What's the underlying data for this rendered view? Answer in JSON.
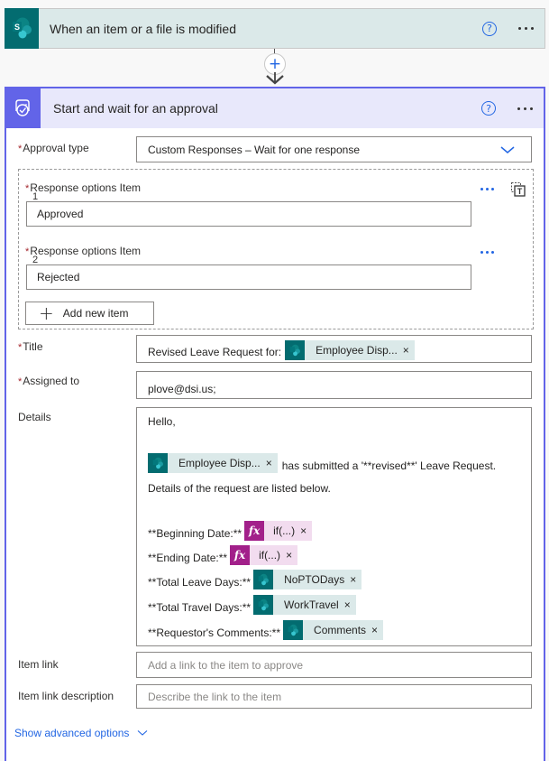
{
  "trigger": {
    "icon": "sharepoint-icon",
    "title": "When an item or a file is modified",
    "help_icon": "?",
    "more_icon": "ellipsis-icon"
  },
  "connector": {
    "add_icon": "+",
    "arrow_icon": "arrow-down-icon"
  },
  "action": {
    "icon": "approval-icon",
    "title": "Start and wait for an approval",
    "help_icon": "?",
    "more_icon": "ellipsis-icon",
    "required_marker": "*",
    "approval_type": {
      "label": "Approval type",
      "value": "Custom Responses – Wait for one response"
    },
    "response_options": [
      {
        "label": "Response options Item",
        "index": "1",
        "value": "Approved"
      },
      {
        "label": "Response options Item",
        "index": "2",
        "value": "Rejected"
      }
    ],
    "add_new_item_label": "Add new item",
    "add_new_item_icon": "+",
    "title_field": {
      "label": "Title",
      "prefix_text": "Revised Leave Request for:",
      "token": {
        "type": "sharepoint",
        "text": "Employee Disp...",
        "remove": "×"
      }
    },
    "assigned_to": {
      "label": "Assigned to",
      "value": "plove@dsi.us;"
    },
    "details": {
      "label": "Details",
      "greeting": "Hello,",
      "employee_token": {
        "type": "sharepoint",
        "text": "Employee Disp...",
        "remove": "×"
      },
      "submitted_text": "has submitted a '**revised**' Leave Request.",
      "listed_text": "Details of the request are listed below.",
      "lines": [
        {
          "label": "**Beginning Date:**",
          "token": {
            "type": "fx",
            "icon": "fx",
            "text": "if(...)",
            "remove": "×"
          }
        },
        {
          "label": "**Ending Date:**",
          "token": {
            "type": "fx",
            "icon": "fx",
            "text": "if(...)",
            "remove": "×"
          }
        },
        {
          "label": "**Total Leave Days:**",
          "token": {
            "type": "sharepoint",
            "text": "NoPTODays",
            "remove": "×"
          }
        },
        {
          "label": "**Total Travel Days:**",
          "token": {
            "type": "sharepoint",
            "text": "WorkTravel",
            "remove": "×"
          }
        },
        {
          "label": "**Requestor's Comments:**",
          "token": {
            "type": "sharepoint",
            "text": "Comments",
            "remove": "×"
          }
        }
      ]
    },
    "item_link": {
      "label": "Item link",
      "placeholder": "Add a link to the item to approve"
    },
    "item_link_description": {
      "label": "Item link description",
      "placeholder": "Describe the link to the item"
    },
    "show_advanced_label": "Show advanced options"
  },
  "colors": {
    "sharepoint_brand": "#036c70",
    "sharepoint_token_bg": "#dbe9e9",
    "approval_brand": "#6264e8",
    "approval_header_bg": "#e8e8fb",
    "fx_brand": "#a2208a",
    "fx_token_bg": "#f2dcef",
    "link_blue": "#2266e3",
    "required_red": "#a4262c"
  }
}
